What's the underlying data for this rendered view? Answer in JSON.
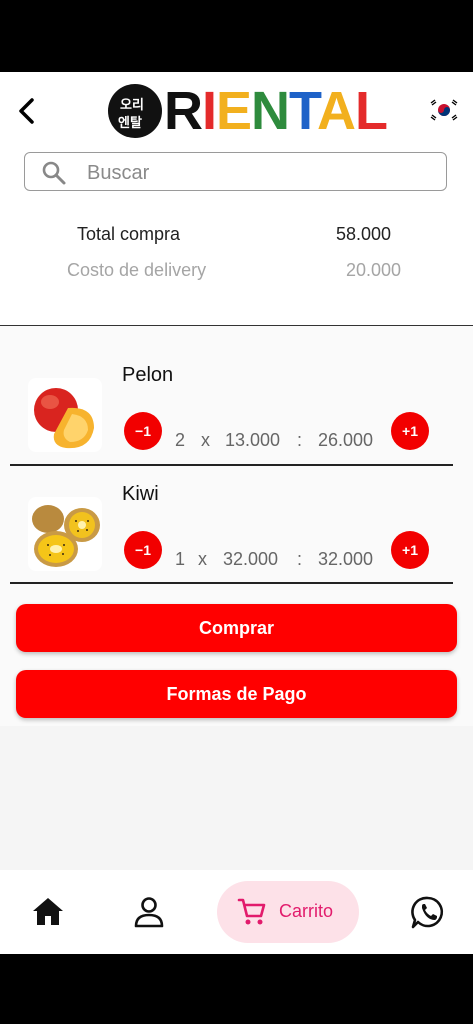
{
  "header": {
    "logo_text": "ORIENTAL",
    "back_icon": "chevron-left-icon",
    "flag_icon": "korea-flag-icon"
  },
  "search": {
    "placeholder": "Buscar",
    "value": ""
  },
  "summary": {
    "total_label": "Total compra",
    "total_value": "58.000",
    "delivery_label": "Costo de delivery",
    "delivery_value": "20.000"
  },
  "cart": {
    "items": [
      {
        "name": "Pelon",
        "qty": "2",
        "x": "x",
        "price": "13.000",
        "colon": ":",
        "subtotal": "26.000",
        "minus": "−1",
        "plus": "+1"
      },
      {
        "name": "Kiwi",
        "qty": "1",
        "x": "x",
        "price": "32.000",
        "colon": ":",
        "subtotal": "32.000",
        "minus": "−1",
        "plus": "+1"
      }
    ]
  },
  "actions": {
    "buy_label": "Comprar",
    "payment_label": "Formas de Pago"
  },
  "nav": {
    "home_icon": "home-icon",
    "profile_icon": "user-icon",
    "cart_icon": "cart-icon",
    "cart_label": "Carrito",
    "whatsapp_icon": "whatsapp-icon"
  },
  "colors": {
    "accent": "#ff0000",
    "cart_pill_bg": "#fde1e8",
    "cart_pill_text": "#e21b6c"
  }
}
